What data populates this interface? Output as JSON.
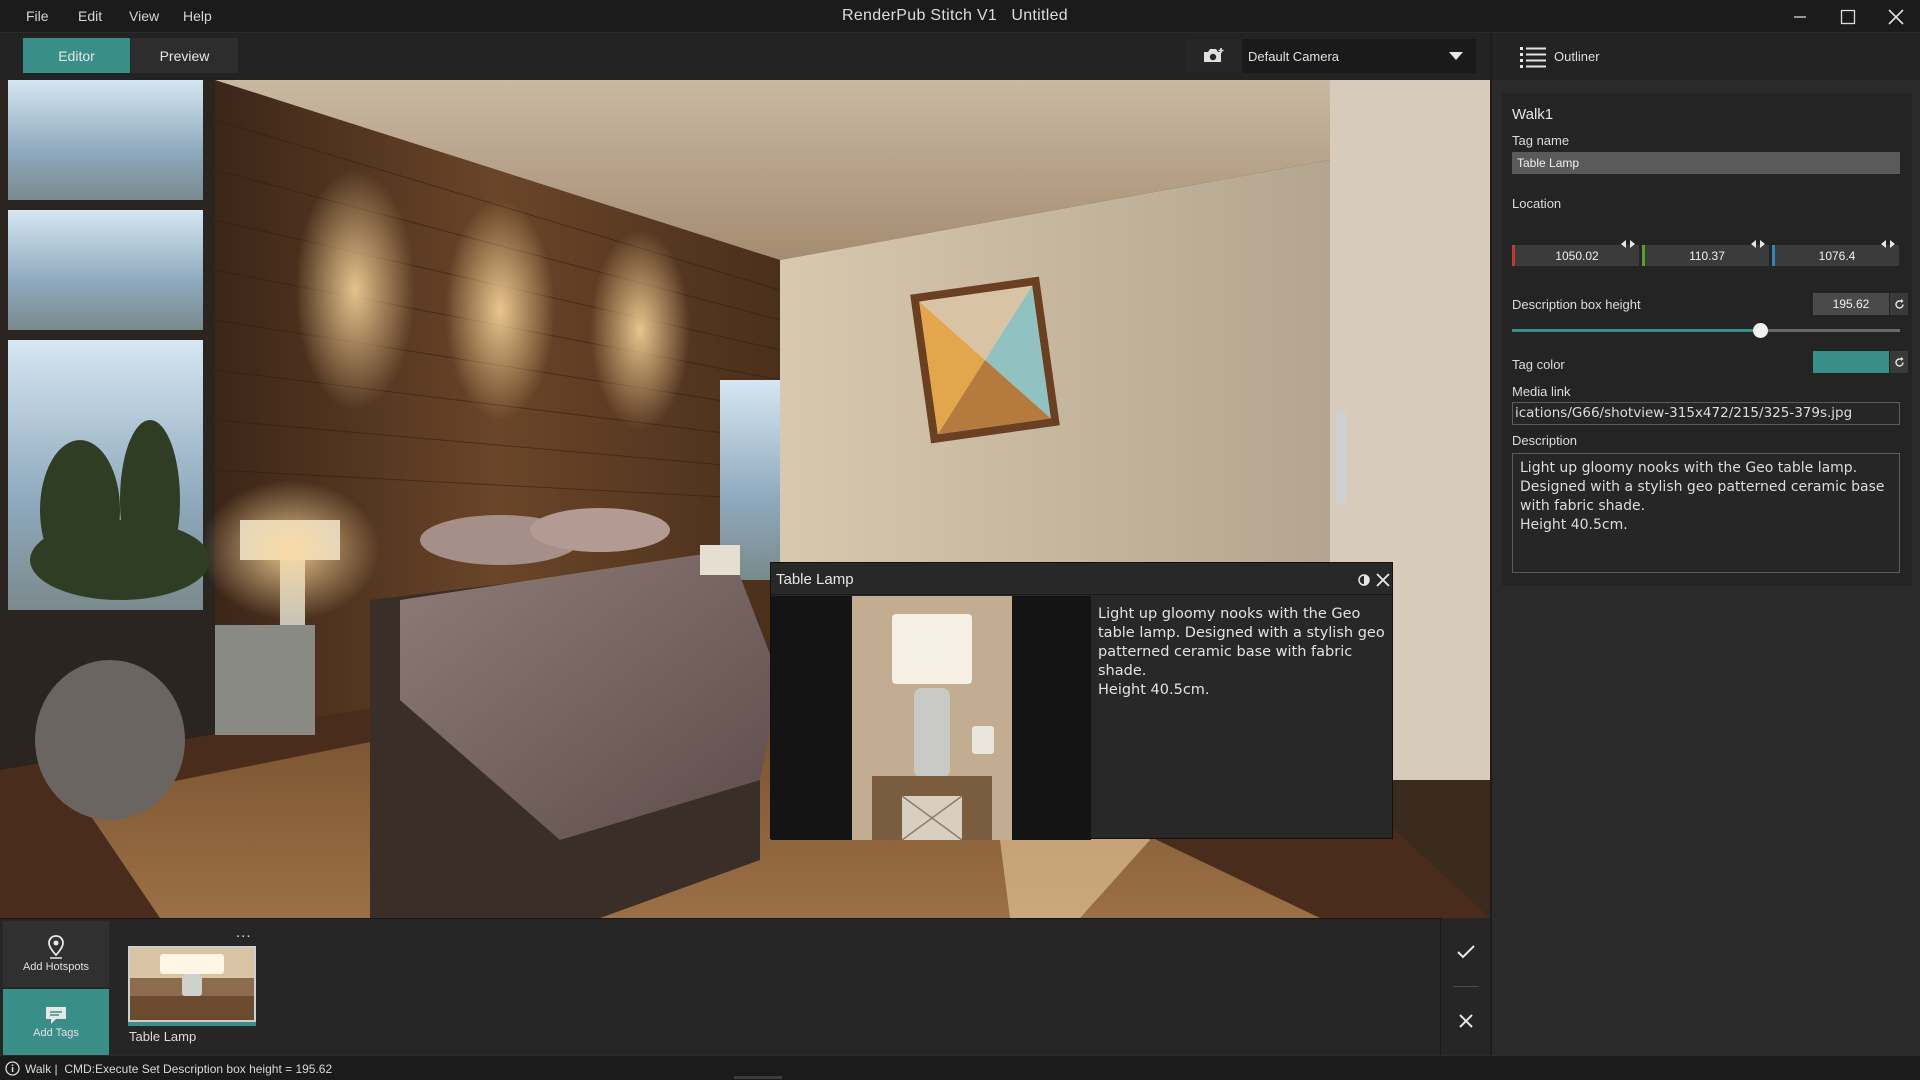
{
  "menu": {
    "file": "File",
    "edit": "Edit",
    "view": "View",
    "help": "Help"
  },
  "app": {
    "title": "RenderPub Stitch V1   Untitled"
  },
  "toolbar": {
    "editor_label": "Editor",
    "preview_label": "Preview",
    "camera": {
      "selected": "Default Camera",
      "icon": "camera-add-icon"
    }
  },
  "popup": {
    "title": "Table Lamp",
    "description": "Light up gloomy nooks with the Geo table lamp. Designed with a stylish geo patterned ceramic base with fabric shade.\nHeight 40.5cm."
  },
  "bottom": {
    "add_hotspots": "Add Hotspots",
    "add_tags": "Add Tags",
    "more": "...",
    "tags": [
      {
        "label": "Table Lamp"
      }
    ]
  },
  "outliner": {
    "header": "Outliner",
    "object_name": "Walk1",
    "tag_name_label": "Tag name",
    "tag_name_value": "Table Lamp",
    "location_label": "Location",
    "location": {
      "x": "1050.02",
      "y": "110.37",
      "z": "1076.4"
    },
    "desc_height_label": "Description box height",
    "desc_height_value": "195.62",
    "desc_height_slider_fraction": 0.64,
    "tag_color_label": "Tag color",
    "tag_color": "#3a8e88",
    "media_link_label": "Media link",
    "media_link_value": "ications/G66/shotview-315x472/215/325-379s.jpg",
    "description_label": "Description",
    "description_value": "Light up gloomy nooks with the Geo table lamp. Designed with a stylish geo patterned ceramic base with fabric shade.\nHeight 40.5cm."
  },
  "status": {
    "text": "Walk |  CMD:Execute Set Description box height = 195.62"
  },
  "colors": {
    "accent": "#3a8e88",
    "x_axis": "#c0392b",
    "y_axis": "#5aa02c",
    "z_axis": "#2e86c1"
  }
}
